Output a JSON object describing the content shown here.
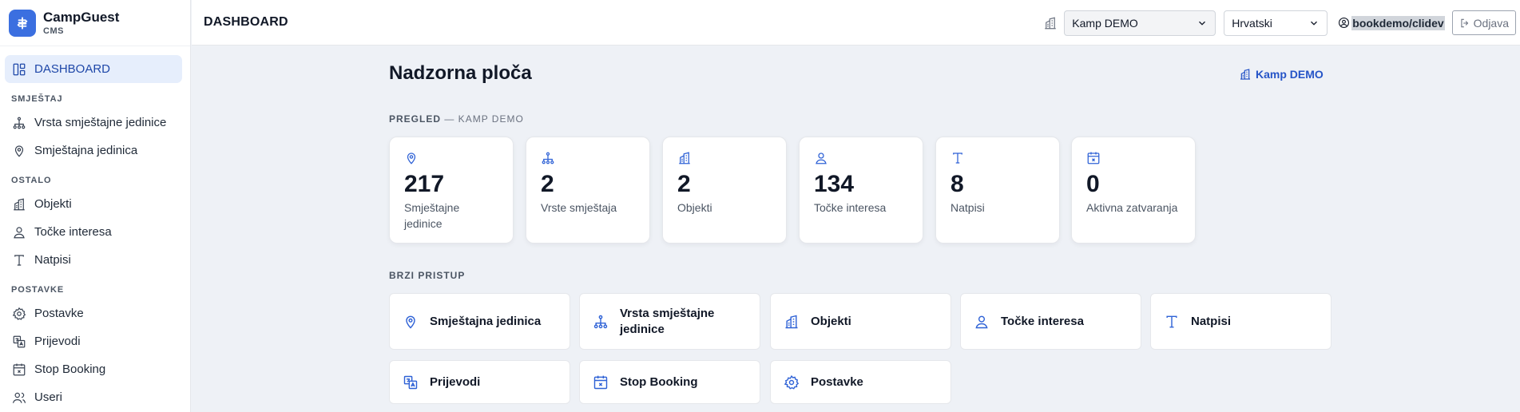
{
  "brand": {
    "name": "CampGuest",
    "sub": "CMS"
  },
  "sidebar": {
    "active": {
      "label": "DASHBOARD",
      "icon": "dashboard-icon"
    },
    "sections": [
      {
        "title": "SMJEŠTAJ",
        "items": [
          {
            "label": "Vrsta smještajne jedinice",
            "icon": "hierarchy-icon"
          },
          {
            "label": "Smještajna jedinica",
            "icon": "map-pin-icon"
          }
        ]
      },
      {
        "title": "OSTALO",
        "items": [
          {
            "label": "Objekti",
            "icon": "building-icon"
          },
          {
            "label": "Točke interesa",
            "icon": "person-pin-icon"
          },
          {
            "label": "Natpisi",
            "icon": "text-icon"
          }
        ]
      },
      {
        "title": "POSTAVKE",
        "items": [
          {
            "label": "Postavke",
            "icon": "gear-icon"
          },
          {
            "label": "Prijevodi",
            "icon": "translate-icon"
          },
          {
            "label": "Stop Booking",
            "icon": "calendar-x-icon"
          },
          {
            "label": "Useri",
            "icon": "users-icon"
          }
        ]
      }
    ]
  },
  "header": {
    "title": "DASHBOARD",
    "camp_select": "Kamp DEMO",
    "language_select": "Hrvatski",
    "user": "bookdemo/clidev",
    "logout": "Odjava"
  },
  "main": {
    "title": "Nadzorna ploča",
    "camp_link": "Kamp DEMO",
    "overview_label": "PREGLED",
    "overview_sub": " — KAMP DEMO",
    "stats": [
      {
        "value": "217",
        "label": "Smještajne jedinice",
        "icon": "map-pin-icon"
      },
      {
        "value": "2",
        "label": "Vrste smještaja",
        "icon": "hierarchy-icon"
      },
      {
        "value": "2",
        "label": "Objekti",
        "icon": "building-icon"
      },
      {
        "value": "134",
        "label": "Točke interesa",
        "icon": "person-pin-icon"
      },
      {
        "value": "8",
        "label": "Natpisi",
        "icon": "text-icon"
      },
      {
        "value": "0",
        "label": "Aktivna zatvaranja",
        "icon": "calendar-x-icon"
      }
    ],
    "quick_label": "BRZI PRISTUP",
    "quick": [
      {
        "label": "Smještajna jedinica",
        "icon": "map-pin-icon"
      },
      {
        "label": "Vrsta smještajne jedinice",
        "icon": "hierarchy-icon"
      },
      {
        "label": "Objekti",
        "icon": "building-icon"
      },
      {
        "label": "Točke interesa",
        "icon": "person-pin-icon"
      },
      {
        "label": "Natpisi",
        "icon": "text-icon"
      },
      {
        "label": "Prijevodi",
        "icon": "translate-icon"
      },
      {
        "label": "Stop Booking",
        "icon": "calendar-x-icon"
      },
      {
        "label": "Postavke",
        "icon": "gear-icon"
      }
    ]
  },
  "colors": {
    "accent": "#3b6fe0",
    "active_bg": "#e6eefc",
    "link": "#2554c7",
    "background": "#eef1f6"
  }
}
